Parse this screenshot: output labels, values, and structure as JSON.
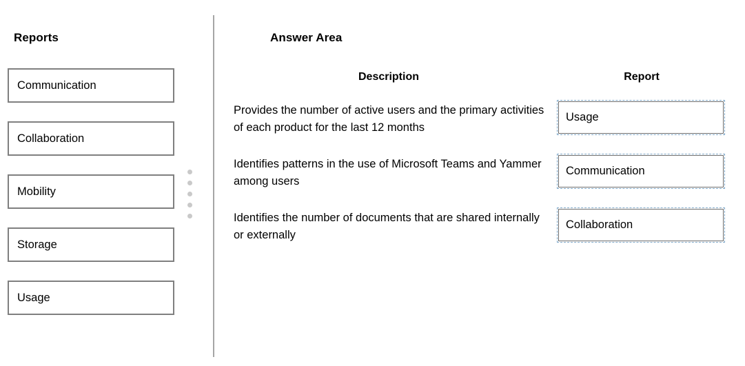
{
  "left_panel": {
    "heading": "Reports",
    "tiles": [
      {
        "label": "Communication"
      },
      {
        "label": "Collaboration"
      },
      {
        "label": "Mobility"
      },
      {
        "label": "Storage"
      },
      {
        "label": "Usage"
      }
    ],
    "drag_handle": {
      "dot_count": 5,
      "dot_color": "#c9c9c9"
    }
  },
  "answer_area": {
    "heading": "Answer Area",
    "columns": {
      "description": "Description",
      "report": "Report"
    },
    "rows": [
      {
        "description": "Provides the number of active users and the primary activities of each product for the last 12 months",
        "answer": "Usage"
      },
      {
        "description": "Identifies patterns in the use of Microsoft Teams and Yammer among users",
        "answer": "Communication"
      },
      {
        "description": "Identifies the number of documents that are shared internally or externally",
        "answer": "Collaboration"
      }
    ]
  },
  "colors": {
    "tile_border": "#7f7f7f",
    "divider": "#a6a6a6",
    "answer_outer_border": "#7fa8c9",
    "answer_inner_border": "#6e6e6e",
    "text": "#000000",
    "background": "#ffffff"
  }
}
